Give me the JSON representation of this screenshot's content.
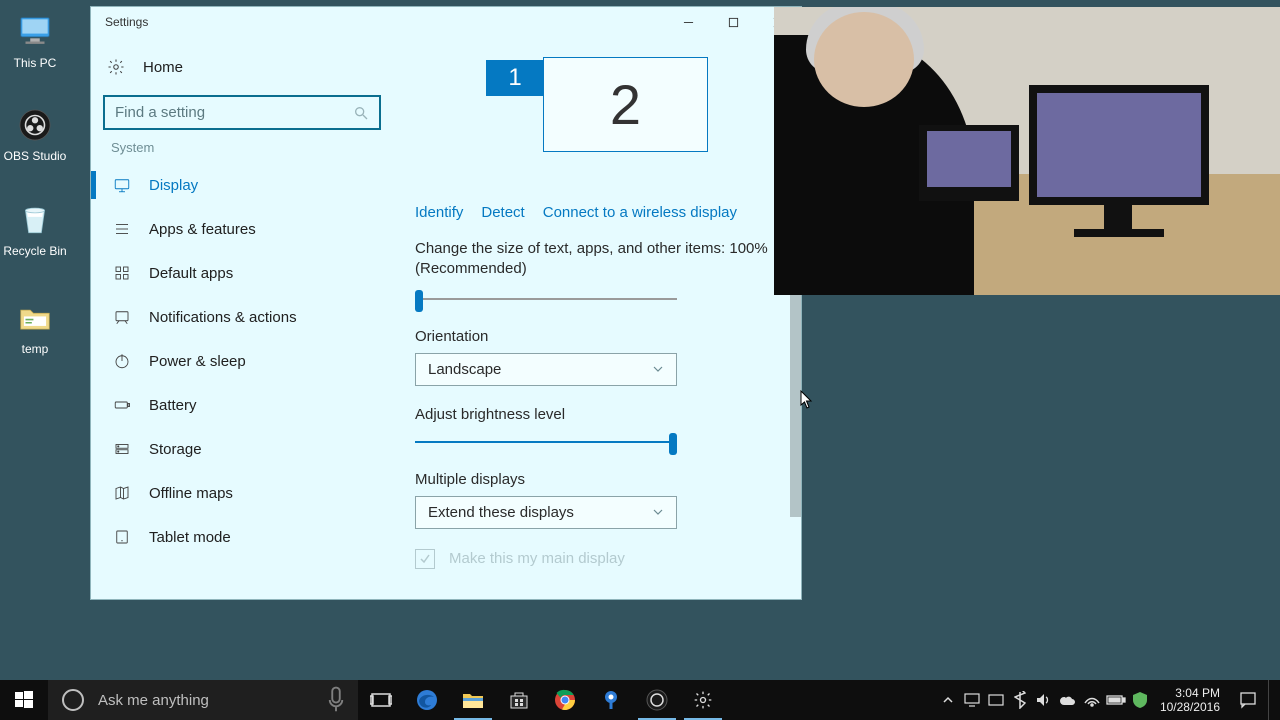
{
  "desktop": {
    "icons": [
      {
        "label": "This PC"
      },
      {
        "label": "OBS Studio"
      },
      {
        "label": "Recycle Bin"
      },
      {
        "label": "temp"
      }
    ]
  },
  "window": {
    "title": "Settings",
    "home": "Home",
    "search_placeholder": "Find a setting",
    "group": "System",
    "nav": [
      {
        "label": "Display"
      },
      {
        "label": "Apps & features"
      },
      {
        "label": "Default apps"
      },
      {
        "label": "Notifications & actions"
      },
      {
        "label": "Power & sleep"
      },
      {
        "label": "Battery"
      },
      {
        "label": "Storage"
      },
      {
        "label": "Offline maps"
      },
      {
        "label": "Tablet mode"
      }
    ]
  },
  "content": {
    "monitor1": "1",
    "monitor2": "2",
    "links": {
      "identify": "Identify",
      "detect": "Detect",
      "wireless": "Connect to a wireless display"
    },
    "scale_label": "Change the size of text, apps, and other items: 100% (Recommended)",
    "orientation_label": "Orientation",
    "orientation_value": "Landscape",
    "brightness_label": "Adjust brightness level",
    "multiple_label": "Multiple displays",
    "multiple_value": "Extend these displays",
    "main_display_label": "Make this my main display"
  },
  "taskbar": {
    "cortana": "Ask me anything",
    "clock_time": "3:04 PM",
    "clock_date": "10/28/2016"
  }
}
